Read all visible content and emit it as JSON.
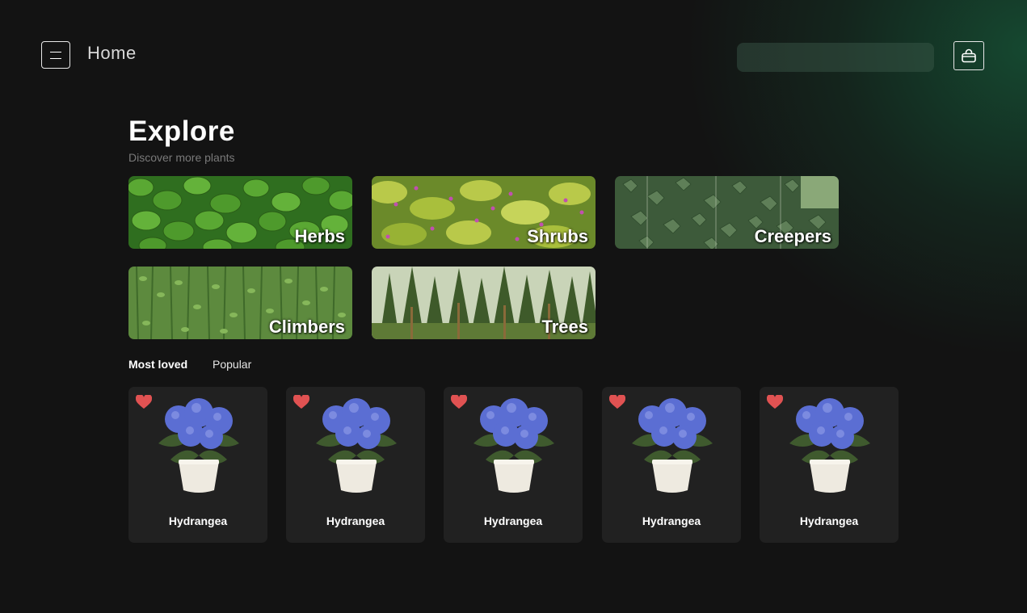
{
  "header": {
    "title": "Home",
    "menu_icon": "menu-icon",
    "bag_icon": "shopping-bag-icon",
    "search": {
      "value": "",
      "placeholder": ""
    }
  },
  "explore": {
    "title": "Explore",
    "subtitle": "Discover more plants",
    "categories": [
      {
        "label": "Herbs"
      },
      {
        "label": "Shrubs"
      },
      {
        "label": "Creepers"
      },
      {
        "label": "Climbers"
      },
      {
        "label": "Trees"
      }
    ]
  },
  "tabs": [
    {
      "label": "Most loved",
      "active": true
    },
    {
      "label": "Popular",
      "active": false
    }
  ],
  "plants": [
    {
      "name": "Hydrangea",
      "favorite": true
    },
    {
      "name": "Hydrangea",
      "favorite": true
    },
    {
      "name": "Hydrangea",
      "favorite": true
    },
    {
      "name": "Hydrangea",
      "favorite": true
    },
    {
      "name": "Hydrangea",
      "favorite": true
    }
  ],
  "colors": {
    "background": "#131313",
    "accent_glow": "#165a3a",
    "card": "#212121",
    "heart": "#e05252",
    "flower": "#5b6ed3"
  }
}
